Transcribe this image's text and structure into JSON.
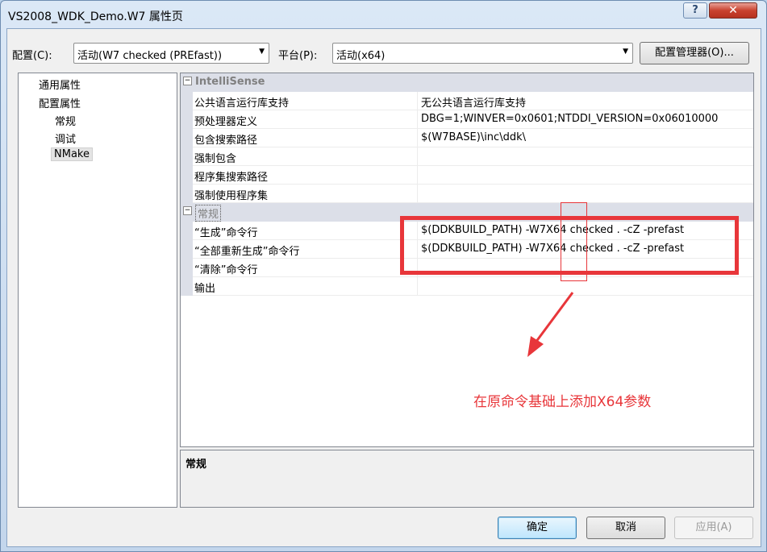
{
  "window": {
    "title": "VS2008_WDK_Demo.W7 属性页",
    "help_label": "?",
    "close_label": "✕"
  },
  "toolbar": {
    "config_label": "配置(C):",
    "config_value": "活动(W7 checked (PREfast))",
    "platform_label": "平台(P):",
    "platform_value": "活动(x64)",
    "config_manager_label": "配置管理器(O)..."
  },
  "tree": {
    "items": [
      {
        "label": "通用属性"
      },
      {
        "label": "配置属性"
      },
      {
        "label": "常规"
      },
      {
        "label": "调试"
      },
      {
        "label": "NMake"
      }
    ]
  },
  "grid": {
    "categories": [
      {
        "label": "IntelliSense",
        "toggle": "⊟",
        "rows": [
          {
            "name": "公共语言运行库支持",
            "value": "无公共语言运行库支持"
          },
          {
            "name": "预处理器定义",
            "value": "DBG=1;WINVER=0x0601;NTDDI_VERSION=0x06010000"
          },
          {
            "name": "包含搜索路径",
            "value": "$(W7BASE)\\inc\\ddk\\"
          },
          {
            "name": "强制包含",
            "value": ""
          },
          {
            "name": "程序集搜索路径",
            "value": ""
          },
          {
            "name": "强制使用程序集",
            "value": ""
          }
        ]
      },
      {
        "label": "常规",
        "toggle": "⊟",
        "rows": [
          {
            "name": "“生成”命令行",
            "value": "$(DDKBUILD_PATH) -W7X64 checked . -cZ -prefast"
          },
          {
            "name": "“全部重新生成”命令行",
            "value": "$(DDKBUILD_PATH) -W7X64 checked . -cZ -prefast"
          },
          {
            "name": "“清除”命令行",
            "value": ""
          },
          {
            "name": "输出",
            "value": ""
          }
        ]
      }
    ]
  },
  "description": {
    "title": "常规"
  },
  "annotation": {
    "text": "在原命令基础上添加X64参数",
    "color": "#e8363a"
  },
  "buttons": {
    "ok": "确定",
    "cancel": "取消",
    "apply": "应用(A)"
  }
}
